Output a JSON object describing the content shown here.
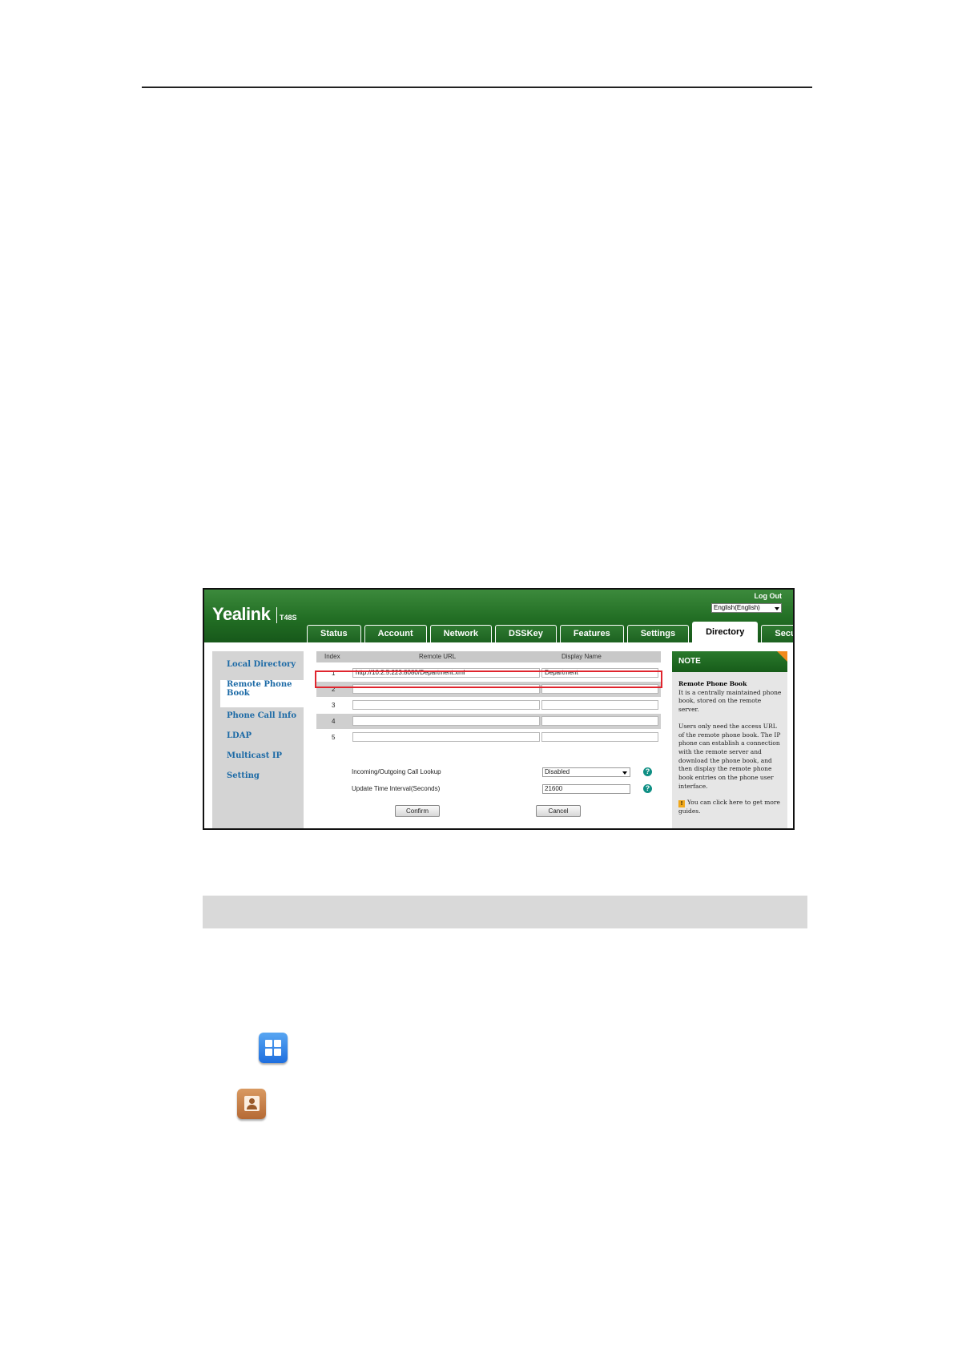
{
  "screenshot": {
    "brand": "Yealink",
    "model": "T48S",
    "logout": "Log Out",
    "language": "English(English)",
    "tabs": [
      "Status",
      "Account",
      "Network",
      "DSSKey",
      "Features",
      "Settings",
      "Directory",
      "Security"
    ],
    "active_tab": "Directory",
    "sidebar": [
      "Local Directory",
      "Remote Phone Book",
      "Phone Call Info",
      "LDAP",
      "Multicast IP",
      "Setting"
    ],
    "active_sidebar": "Remote Phone Book",
    "table": {
      "headers": [
        "Index",
        "Remote URL",
        "Display Name"
      ],
      "rows": [
        {
          "index": "1",
          "url": "http://10.2.5.223:8080/Department.xml",
          "name": "Department"
        },
        {
          "index": "2",
          "url": "",
          "name": ""
        },
        {
          "index": "3",
          "url": "",
          "name": ""
        },
        {
          "index": "4",
          "url": "",
          "name": ""
        },
        {
          "index": "5",
          "url": "",
          "name": ""
        }
      ]
    },
    "lookup": {
      "label": "Incoming/Outgoing Call Lookup",
      "value": "Disabled"
    },
    "interval": {
      "label": "Update Time Interval(Seconds)",
      "value": "21600"
    },
    "confirm": "Confirm",
    "cancel": "Cancel",
    "note": {
      "header": "NOTE",
      "title": "Remote Phone Book",
      "p1": "It is a centrally maintained phone book, stored on the remote server.",
      "p2": "Users only need the access URL of the remote phone book. The IP phone can establish a connection with the remote server and download the phone book, and then display the remote phone book entries on the phone user interface.",
      "tip": "You can click here to get more guides."
    },
    "colors": {
      "banner": "#226e24",
      "highlight": "#e0252e",
      "link": "#1c6aa6"
    }
  },
  "icons": [
    "menu-icon",
    "directory-icon"
  ]
}
